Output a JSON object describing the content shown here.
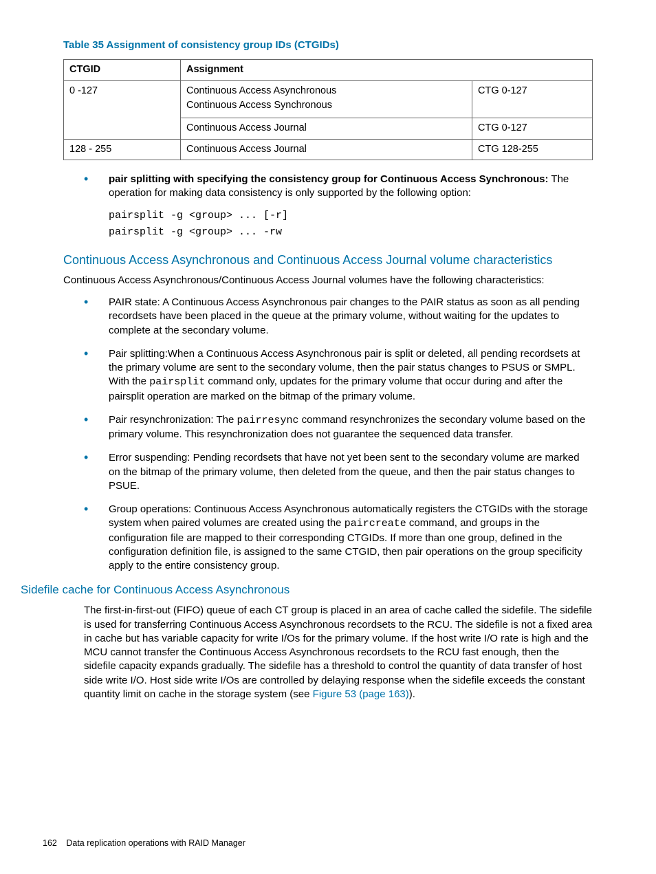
{
  "table": {
    "title": "Table 35 Assignment of consistency group IDs (CTGIDs)",
    "headers": {
      "col1": "CTGID",
      "col2": "Assignment"
    },
    "rows": [
      {
        "ctgid": "0 -127",
        "sub": [
          {
            "assign_a": "Continuous Access Asynchronous",
            "assign_b": "Continuous Access Synchronous",
            "ctg": "CTG 0-127"
          },
          {
            "assign_a": "Continuous Access Journal",
            "assign_b": "",
            "ctg": "CTG 0-127"
          }
        ]
      },
      {
        "ctgid": "128 - 255",
        "sub": [
          {
            "assign_a": "Continuous Access Journal",
            "assign_b": "",
            "ctg": "CTG 128-255"
          }
        ]
      }
    ]
  },
  "firstBullet": {
    "lead": "pair splitting with specifying the consistency group for Continuous Access Synchronous:",
    "tail": " The operation for making data consistency is only supported by the following option:"
  },
  "codeBlock": "pairsplit -g <group> ... [-r]\npairsplit -g <group> ... -rw",
  "section1": {
    "heading": "Continuous Access Asynchronous and Continuous Access Journal volume characteristics",
    "intro": "Continuous Access Asynchronous/Continuous Access Journal volumes have the following characteristics:",
    "items": {
      "b1": "PAIR state: A Continuous Access Asynchronous pair changes to the PAIR status as soon as all pending recordsets have been placed in the queue at the primary volume, without waiting for the updates to complete at the secondary volume.",
      "b2_a": "Pair splitting:When a Continuous Access Asynchronous pair is split or deleted, all pending recordsets at the primary volume are sent to the secondary volume, then the pair status changes to PSUS or SMPL. With the ",
      "b2_code": "pairsplit",
      "b2_b": " command only, updates for the primary volume that occur during and after the pairsplit operation are marked on the bitmap of the primary volume.",
      "b3_a": "Pair resynchronization: The ",
      "b3_code": "pairresync",
      "b3_b": " command resynchronizes the secondary volume based on the primary volume. This resynchronization does not guarantee the sequenced data transfer.",
      "b4": "Error suspending: Pending recordsets that have not yet been sent to the secondary volume are marked on the bitmap of the primary volume, then deleted from the queue, and then the pair status changes to PSUE.",
      "b5_a": "Group operations: Continuous Access Asynchronous automatically registers the CTGIDs with the storage system when paired volumes are created using the ",
      "b5_code": "paircreate",
      "b5_b": " command, and groups in the configuration file are mapped to their corresponding CTGIDs. If more than one group, defined in the configuration definition file, is assigned to the same CTGID, then pair operations on the group specificity apply to the entire consistency group."
    }
  },
  "section2": {
    "heading": "Sidefile cache for Continuous Access Asynchronous",
    "para_a": "The first-in-first-out (FIFO) queue of each CT group is placed in an area of cache called the sidefile. The sidefile is used for transferring Continuous Access Asynchronous recordsets to the RCU. The sidefile is not a fixed area in cache but has variable capacity for write I/Os for the primary volume. If the host write I/O rate is high and the MCU cannot transfer the Continuous Access Asynchronous recordsets to the RCU fast enough, then the sidefile capacity expands gradually. The sidefile has a threshold to control the quantity of data transfer of host side write I/O. Host side write I/Os are controlled by delaying response when the sidefile exceeds the constant quantity limit on cache in the storage system (see ",
    "xref": "Figure 53 (page 163)",
    "para_b": ")."
  },
  "footer": {
    "page": "162",
    "text": "Data replication operations with RAID Manager"
  }
}
